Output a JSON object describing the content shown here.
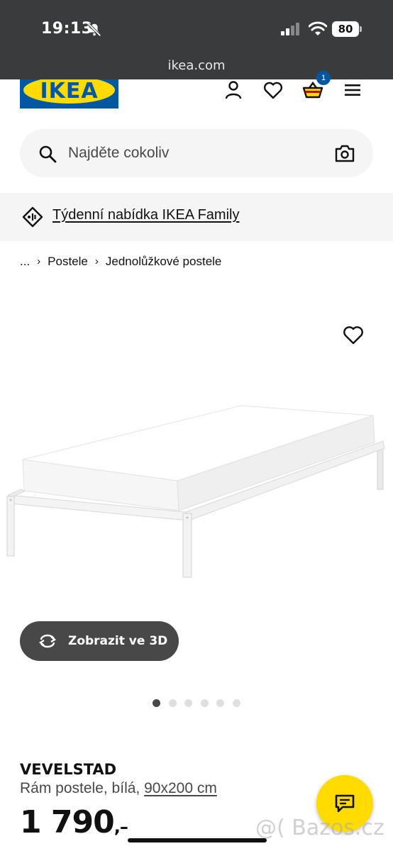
{
  "status_bar": {
    "time": "19:13",
    "battery": "80",
    "url": "ikea.com",
    "icons": [
      "bell-slash-icon",
      "signal-icon",
      "wifi-icon",
      "battery-icon"
    ]
  },
  "header": {
    "logo_text": "IKEA",
    "cart_count": "1",
    "icons": [
      "user-icon",
      "heart-icon",
      "basket-icon",
      "menu-icon"
    ],
    "colors": {
      "brand_blue": "#0058a3",
      "brand_yellow": "#ffdb00"
    }
  },
  "search": {
    "placeholder": "Najděte cokoliv",
    "icons": [
      "search-icon",
      "camera-icon"
    ]
  },
  "offer_banner": {
    "text": "Týdenní nabídka IKEA Family",
    "icon": "tag-icon"
  },
  "breadcrumb": {
    "ellipsis": "...",
    "items": [
      "Postele",
      "Jednolůžkové postele"
    ]
  },
  "product_gallery": {
    "favourite_icon": "heart-icon",
    "view_3d_label": "Zobrazit ve 3D",
    "view_3d_icon": "rotate-icon",
    "dot_count": 6,
    "active_dot": 1
  },
  "product": {
    "name": "VEVELSTAD",
    "description": "Rám postele, bílá,",
    "size": "90x200 cm",
    "price": "1 790",
    "price_suffix": ",–"
  },
  "chat": {
    "icon": "chat-icon"
  },
  "watermark": {
    "text": "@( Bazos.cz"
  }
}
